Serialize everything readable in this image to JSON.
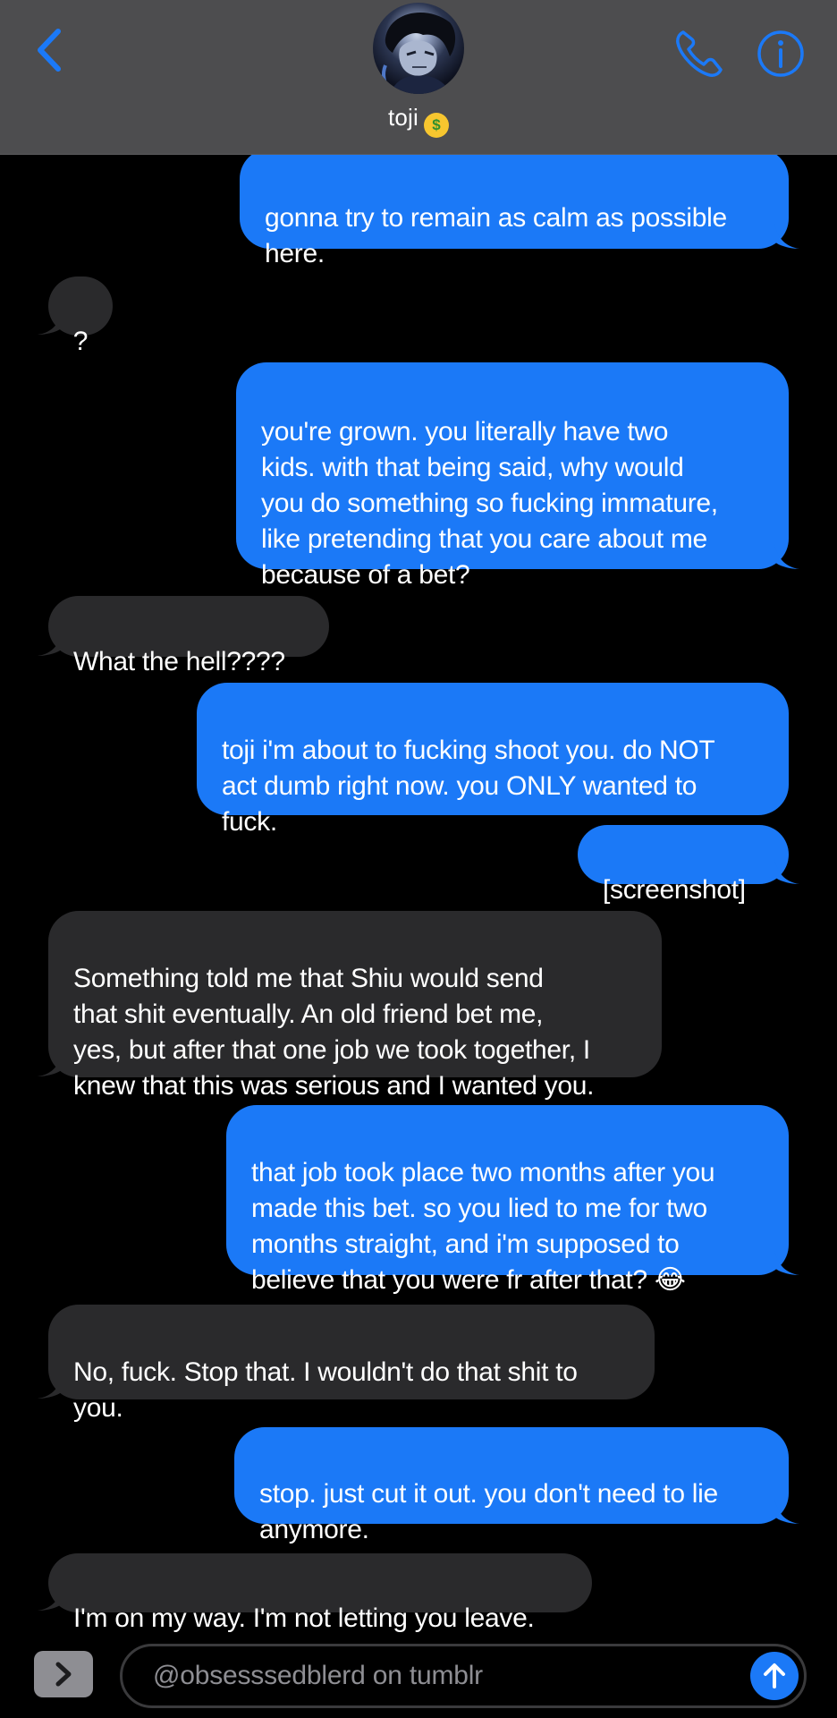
{
  "header": {
    "contact_name": "toji",
    "contact_emoji": "money-mouth-face",
    "icons": {
      "back": "chevron-left-icon",
      "call": "phone-icon",
      "info": "info-icon"
    },
    "accent_color": "#1b79f7"
  },
  "messages": [
    {
      "from": "me",
      "text": "gonna try to remain as calm as possible\nhere."
    },
    {
      "from": "them",
      "text": "?"
    },
    {
      "from": "me",
      "text": "you're grown. you literally have two\nkids. with that being said, why would\nyou do something so fucking immature,\nlike pretending that you care about me\nbecause of a bet?"
    },
    {
      "from": "them",
      "text": "What the hell????"
    },
    {
      "from": "me",
      "text": "toji i'm about to fucking shoot you. do NOT\nact dumb right now. you ONLY wanted to\nfuck."
    },
    {
      "from": "me",
      "text": "[screenshot]"
    },
    {
      "from": "them",
      "text": "Something told me that Shiu would send\nthat shit eventually. An old friend bet me,\nyes, but after that one job we took together, I\nknew that this was serious and I wanted you."
    },
    {
      "from": "me",
      "text": "that job took place two months after you\nmade this bet. so you lied to me for two\nmonths straight, and i'm supposed to\nbelieve that you were fr after that? 😂"
    },
    {
      "from": "them",
      "text": "No, fuck. Stop that. I wouldn't do that shit to\nyou."
    },
    {
      "from": "me",
      "text": "stop. just cut it out. you don't need to lie\nanymore."
    },
    {
      "from": "them",
      "text": "I'm on my way. I'm not letting you leave."
    }
  ],
  "composer": {
    "text": "@obsesssedblerd on tumblr",
    "icons": {
      "apps": "chevron-right-icon",
      "send": "arrow-up-icon"
    }
  },
  "colors": {
    "sent_bubble": "#1b79f7",
    "received_bubble": "#2a2a2c",
    "header_bg": "#4d4d4f",
    "background": "#000000"
  }
}
